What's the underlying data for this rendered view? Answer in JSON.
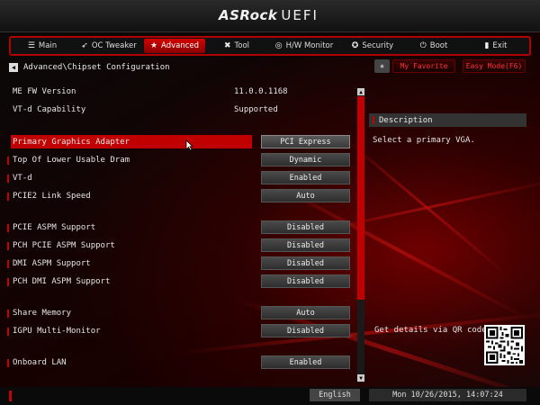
{
  "header": {
    "brand": "ASRock",
    "product": "UEFI"
  },
  "tabs": [
    {
      "label": "Main",
      "icon": "list-icon"
    },
    {
      "label": "OC Tweaker",
      "icon": "rocket-icon"
    },
    {
      "label": "Advanced",
      "icon": "star-icon"
    },
    {
      "label": "Tool",
      "icon": "wrench-icon"
    },
    {
      "label": "H/W Monitor",
      "icon": "monitor-icon"
    },
    {
      "label": "Security",
      "icon": "shield-icon"
    },
    {
      "label": "Boot",
      "icon": "power-icon"
    },
    {
      "label": "Exit",
      "icon": "door-icon"
    }
  ],
  "active_tab": "Advanced",
  "breadcrumb": "Advanced\\Chipset Configuration",
  "top_buttons": {
    "favorite": "My Favorite",
    "easy_mode": "Easy Mode(F6)"
  },
  "info": [
    {
      "label": "ME FW Version",
      "value": "11.0.0.1168"
    },
    {
      "label": "VT-d Capability",
      "value": "Supported"
    }
  ],
  "settings": [
    {
      "label": "Primary Graphics Adapter",
      "value": "PCI Express",
      "selected": true
    },
    {
      "label": "Top Of Lower Usable Dram",
      "value": "Dynamic"
    },
    {
      "label": "VT-d",
      "value": "Enabled"
    },
    {
      "label": "PCIE2 Link Speed",
      "value": "Auto"
    },
    {
      "label": "PCIE ASPM Support",
      "value": "Disabled"
    },
    {
      "label": "PCH PCIE ASPM Support",
      "value": "Disabled"
    },
    {
      "label": "DMI ASPM Support",
      "value": "Disabled"
    },
    {
      "label": "PCH DMI ASPM Support",
      "value": "Disabled"
    },
    {
      "label": "Share Memory",
      "value": "Auto"
    },
    {
      "label": "IGPU Multi-Monitor",
      "value": "Disabled"
    },
    {
      "label": "Onboard LAN",
      "value": "Enabled"
    }
  ],
  "description": {
    "title": "Description",
    "text": "Select a primary VGA.",
    "qr_label": "Get details via QR code"
  },
  "footer": {
    "language": "English",
    "datetime": "Mon 10/26/2015, 14:07:24"
  },
  "colors": {
    "accent": "#c00000",
    "background": "#000000"
  }
}
